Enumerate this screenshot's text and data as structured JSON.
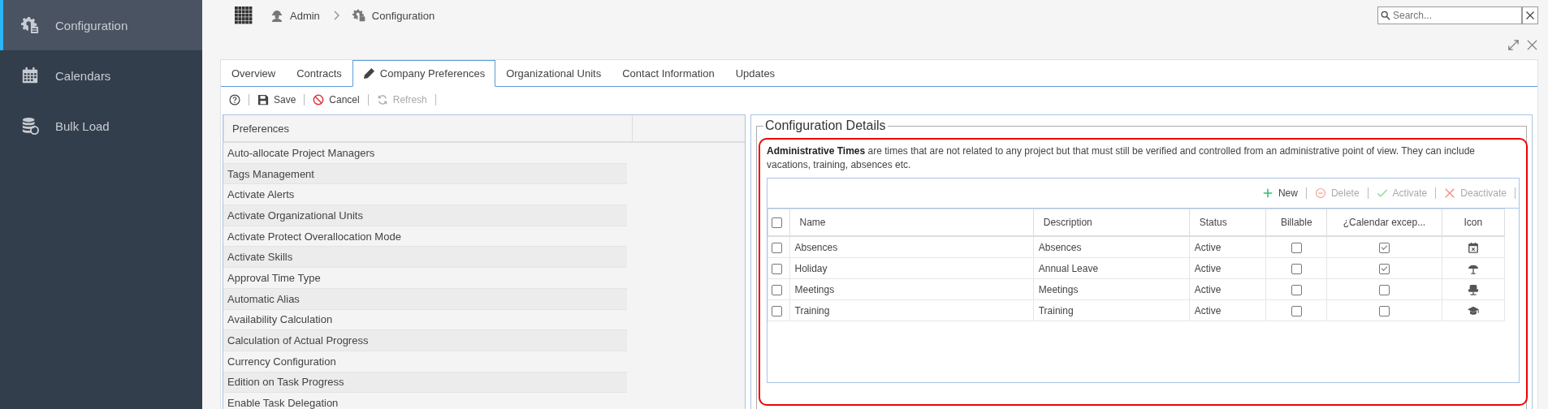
{
  "sidebar": {
    "items": [
      {
        "label": "Configuration",
        "kind": "gear",
        "selected": true
      },
      {
        "label": "Calendars",
        "kind": "calendar",
        "selected": false
      },
      {
        "label": "Bulk Load",
        "kind": "database",
        "selected": false
      }
    ]
  },
  "breadcrumb": [
    {
      "label": "Admin",
      "kind": "user"
    },
    {
      "label": "Configuration",
      "kind": "gear"
    }
  ],
  "search": {
    "placeholder": "Search..."
  },
  "tabs": [
    {
      "label": "Overview",
      "selected": false
    },
    {
      "label": "Contracts",
      "selected": false
    },
    {
      "label": "Company Preferences",
      "selected": true
    },
    {
      "label": "Organizational Units",
      "selected": false
    },
    {
      "label": "Contact Information",
      "selected": false
    },
    {
      "label": "Updates",
      "selected": false
    }
  ],
  "toolbar": [
    {
      "kind": "help"
    },
    {
      "kind": "save",
      "label": "Save",
      "disabled": false
    },
    {
      "kind": "cancel",
      "label": "Cancel",
      "disabled": false
    },
    {
      "kind": "refresh",
      "label": "Refresh",
      "disabled": true
    }
  ],
  "preferences": {
    "heading": "Preferences",
    "items": [
      "Auto-allocate Project Managers",
      "Tags Management",
      "Activate Alerts",
      "Activate Organizational Units",
      "Activate Protect Overallocation Mode",
      "Activate Skills",
      "Approval Time Type",
      "Automatic Alias",
      "Availability Calculation",
      "Calculation of Actual Progress",
      "Currency Configuration",
      "Edition on Task Progress",
      "Enable Task Delegation"
    ]
  },
  "details": {
    "title": "Configuration Details",
    "description": "**Administrative Times** are times that are not related to any project but that must still be verified and controlled from an administrative point of view. They can include vacations, training, absences etc.",
    "grid_toolbar": [
      {
        "kind": "new",
        "label": "New",
        "disabled": false
      },
      {
        "kind": "delete",
        "label": "Delete",
        "disabled": true
      },
      {
        "kind": "activate",
        "label": "Activate",
        "disabled": true
      },
      {
        "kind": "deactivate",
        "label": "Deactivate",
        "disabled": true
      }
    ],
    "columns": [
      "Name",
      "Description",
      "Status",
      "Billable",
      "¿Calendar excep...",
      "Icon"
    ],
    "select_all": {
      "checked": false
    },
    "rows": [
      {
        "selected": false,
        "name": "Absences",
        "description": "Absences",
        "status": "Active",
        "billable": false,
        "calendar_exception": true,
        "kind": "calendar"
      },
      {
        "selected": false,
        "name": "Holiday",
        "description": "Annual Leave",
        "status": "Active",
        "billable": false,
        "calendar_exception": true,
        "kind": "umbrella"
      },
      {
        "selected": false,
        "name": "Meetings",
        "description": "Meetings",
        "status": "Active",
        "billable": false,
        "calendar_exception": false,
        "kind": "chair"
      },
      {
        "selected": false,
        "name": "Training",
        "description": "Training",
        "status": "Active",
        "billable": false,
        "calendar_exception": false,
        "kind": "cap"
      }
    ]
  }
}
